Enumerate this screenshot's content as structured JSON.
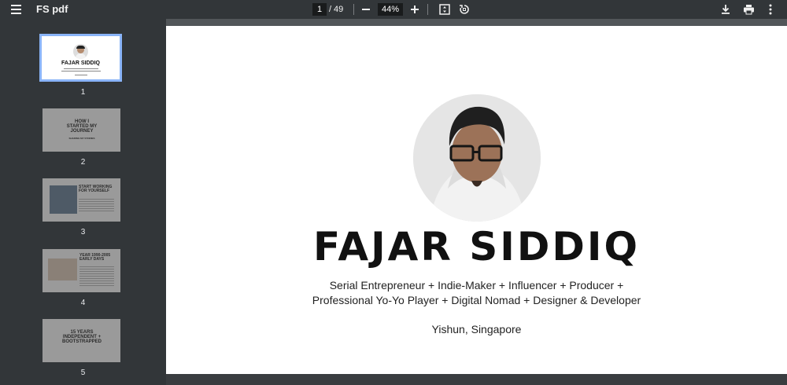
{
  "toolbar": {
    "title": "FS pdf",
    "current_page": "1",
    "page_separator": "/",
    "total_pages": "49",
    "zoom": "44%",
    "icons": [
      "menu-icon",
      "zoom-out-icon",
      "zoom-in-icon",
      "fit-page-icon",
      "rotate-icon",
      "download-icon",
      "print-icon",
      "more-icon"
    ]
  },
  "thumbnails": [
    {
      "number": "1",
      "title": "FAJAR SIDDIQ"
    },
    {
      "number": "2",
      "title": "HOW I STARTED MY JOURNEY",
      "subtitle": "SHARING MY STORIES"
    },
    {
      "number": "3",
      "title": "START WORKING FOR YOURSELF"
    },
    {
      "number": "4",
      "title": "YEAR 1990-2005 EARLY DAYS"
    },
    {
      "number": "5",
      "title": "15 YEARS INDEPENDENT + BOOTSTRAPPED"
    }
  ],
  "slide": {
    "name": "FAJAR SIDDIQ",
    "tagline_line1": "Serial Entrepreneur + Indie-Maker + Influencer + Producer +",
    "tagline_line2": "Professional Yo-Yo Player + Digital Nomad + Designer & Developer",
    "location": "Yishun, Singapore"
  },
  "colors": {
    "toolbar": "#323639",
    "viewer_bg": "#525659",
    "active_thumb_outline": "#8ab4f8"
  }
}
